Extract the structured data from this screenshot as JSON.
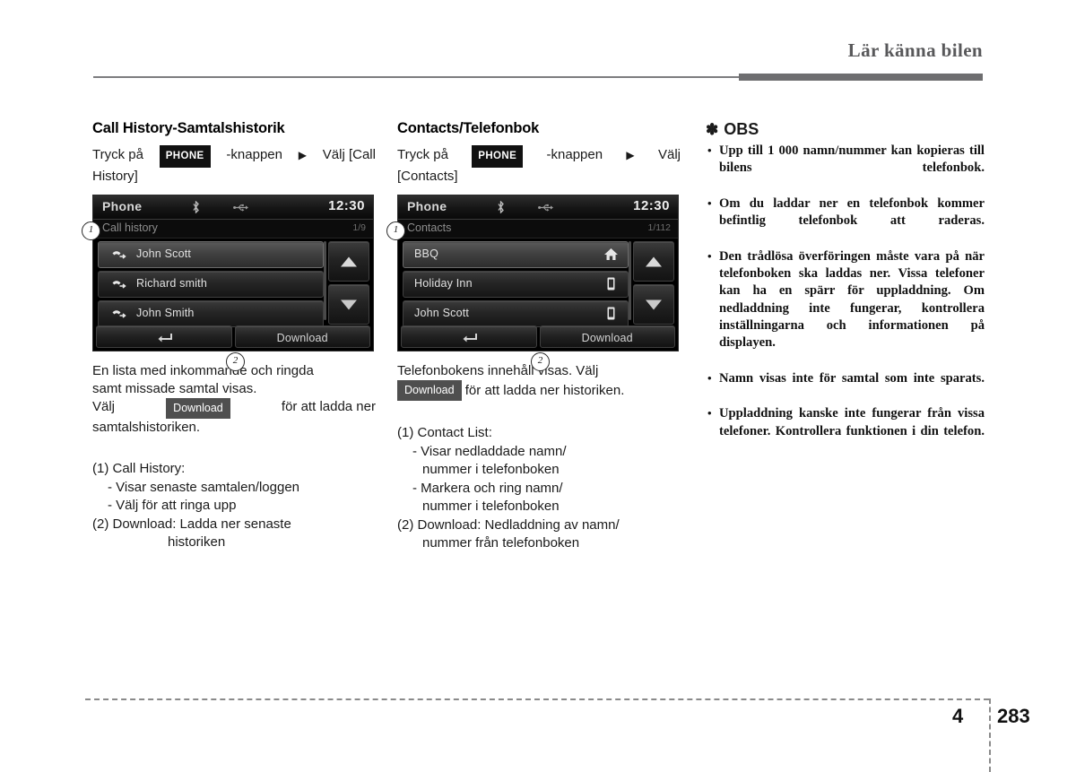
{
  "header": {
    "title": "Lär känna bilen"
  },
  "footer": {
    "chapter": "4",
    "page": "283"
  },
  "left": {
    "section_title": "Call History-Samtalshistorik",
    "intro_pre": "Tryck på",
    "key_chip": "PHONE",
    "intro_mid": "-knappen",
    "arrow": "▶",
    "intro_post": "Välj [Call",
    "intro_line2": "History]",
    "device": {
      "title": "Phone",
      "clock": "12:30",
      "subtitle": "Call history",
      "count": "1/9",
      "items": [
        {
          "name": "John Scott",
          "icon": "outgoing-call-icon"
        },
        {
          "name": "Richard smith",
          "icon": "outgoing-call-icon"
        },
        {
          "name": "John Smith",
          "icon": "outgoing-call-icon"
        }
      ],
      "back_label": "",
      "download_label": "Download",
      "callout_1": "1",
      "callout_2": "2"
    },
    "para1_l1": "En lista med inkommande och ringda",
    "para1_l2": "samt missade samtal visas.",
    "para2_pre": "Välj",
    "para2_chip": "Download",
    "para2_mid": "för att ladda ner",
    "para2_l2": "samtalshistoriken.",
    "legend": [
      {
        "text": "(1) Call History:",
        "style": "li"
      },
      {
        "text": "- Visar senaste samtalen/loggen",
        "style": "sub"
      },
      {
        "text": "- Välj för att ringa upp",
        "style": "sub"
      },
      {
        "text": "(2) Download: Ladda ner senaste",
        "style": "li"
      },
      {
        "text": "historiken",
        "style": "ind"
      }
    ]
  },
  "mid": {
    "section_title": "Contacts/Telefonbok",
    "intro_pre": "Tryck på",
    "key_chip": "PHONE",
    "intro_mid": "-knappen",
    "arrow": "▶",
    "intro_post": "Välj",
    "intro_line2": "[Contacts]",
    "device": {
      "title": "Phone",
      "clock": "12:30",
      "subtitle": "Contacts",
      "count": "1/112",
      "items": [
        {
          "name": "BBQ",
          "icon": "home-icon"
        },
        {
          "name": "Holiday Inn",
          "icon": "mobile-icon"
        },
        {
          "name": "John Scott",
          "icon": "mobile-icon"
        }
      ],
      "back_label": "",
      "download_label": "Download",
      "callout_1": "1",
      "callout_2": "2"
    },
    "para1_l1": "Telefonbokens innehåll visas. Välj",
    "para1_chip": "Download",
    "para1_l2": "för att ladda ner historiken.",
    "legend": [
      {
        "text": "(1) Contact List:",
        "style": "li"
      },
      {
        "text": "- Visar nedladdade namn/",
        "style": "sub"
      },
      {
        "text": "nummer i telefonboken",
        "style": "sub2"
      },
      {
        "text": "- Markera och ring namn/",
        "style": "sub"
      },
      {
        "text": "nummer i telefonboken",
        "style": "sub2"
      },
      {
        "text": "(2) Download: Nedladdning av namn/",
        "style": "li"
      },
      {
        "text": "nummer från telefonboken",
        "style": "ind2"
      }
    ]
  },
  "note": {
    "star": "✽",
    "title": "OBS",
    "items": [
      "Upp till 1 000 namn/nummer kan kopieras till bilens telefonbok.",
      "Om du laddar ner en telefonbok kommer befintlig telefonbok att raderas.",
      "Den trådlösa överföringen måste vara på när telefonboken ska laddas ner. Vissa telefoner kan ha en spärr för uppladdning. Om nedladdning inte fungerar, kontrollera inställningarna och informationen på displayen.",
      "Namn visas inte för samtal som inte sparats.",
      "Uppladdning kanske inte fungerar från vissa telefoner. Kontrollera funktionen i din telefon."
    ]
  }
}
